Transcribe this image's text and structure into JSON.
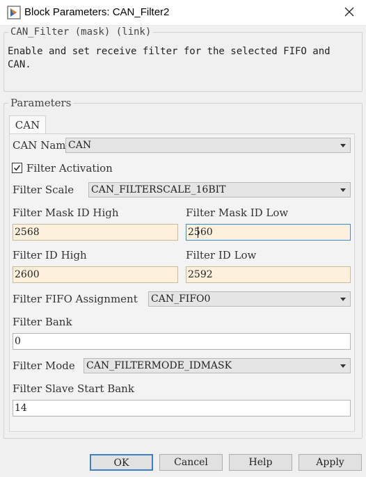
{
  "window": {
    "title": "Block Parameters: CAN_Filter2"
  },
  "description": {
    "header": "CAN_Filter (mask) (link)",
    "text": "Enable and set receive filter for the selected FIFO and CAN."
  },
  "parameters": {
    "legend": "Parameters",
    "tabs": [
      {
        "label": "CAN",
        "active": true
      }
    ],
    "can_name": {
      "label": "CAN Name",
      "value": "CAN"
    },
    "filter_activation": {
      "label": "Filter Activation",
      "checked": true
    },
    "filter_scale": {
      "label": "Filter Scale",
      "value": "CAN_FILTERSCALE_16BIT"
    },
    "filter_mask_id_high": {
      "label": "Filter Mask ID High",
      "value": "2568"
    },
    "filter_mask_id_low": {
      "label": "Filter Mask ID Low",
      "value": "2560"
    },
    "filter_id_high": {
      "label": "Filter ID High",
      "value": "2600"
    },
    "filter_id_low": {
      "label": "Filter ID Low",
      "value": "2592"
    },
    "filter_fifo_assignment": {
      "label": "Filter FIFO Assignment",
      "value": "CAN_FIFO0"
    },
    "filter_bank": {
      "label": "Filter Bank",
      "value": "0"
    },
    "filter_mode": {
      "label": "Filter Mode",
      "value": "CAN_FILTERMODE_IDMASK"
    },
    "filter_slave_start_bank": {
      "label": "Filter Slave Start Bank",
      "value": "14"
    }
  },
  "buttons": {
    "ok": "OK",
    "cancel": "Cancel",
    "help": "Help",
    "apply": "Apply"
  },
  "icons": {
    "app": "simulink-block-icon",
    "close": "close-icon",
    "dropdown": "chevron-down-icon",
    "check": "checkmark-icon"
  },
  "colors": {
    "edited_field_bg": "#fdf1de",
    "focus_border": "#3c8ad6",
    "default_button_border": "#3c7fc6"
  }
}
